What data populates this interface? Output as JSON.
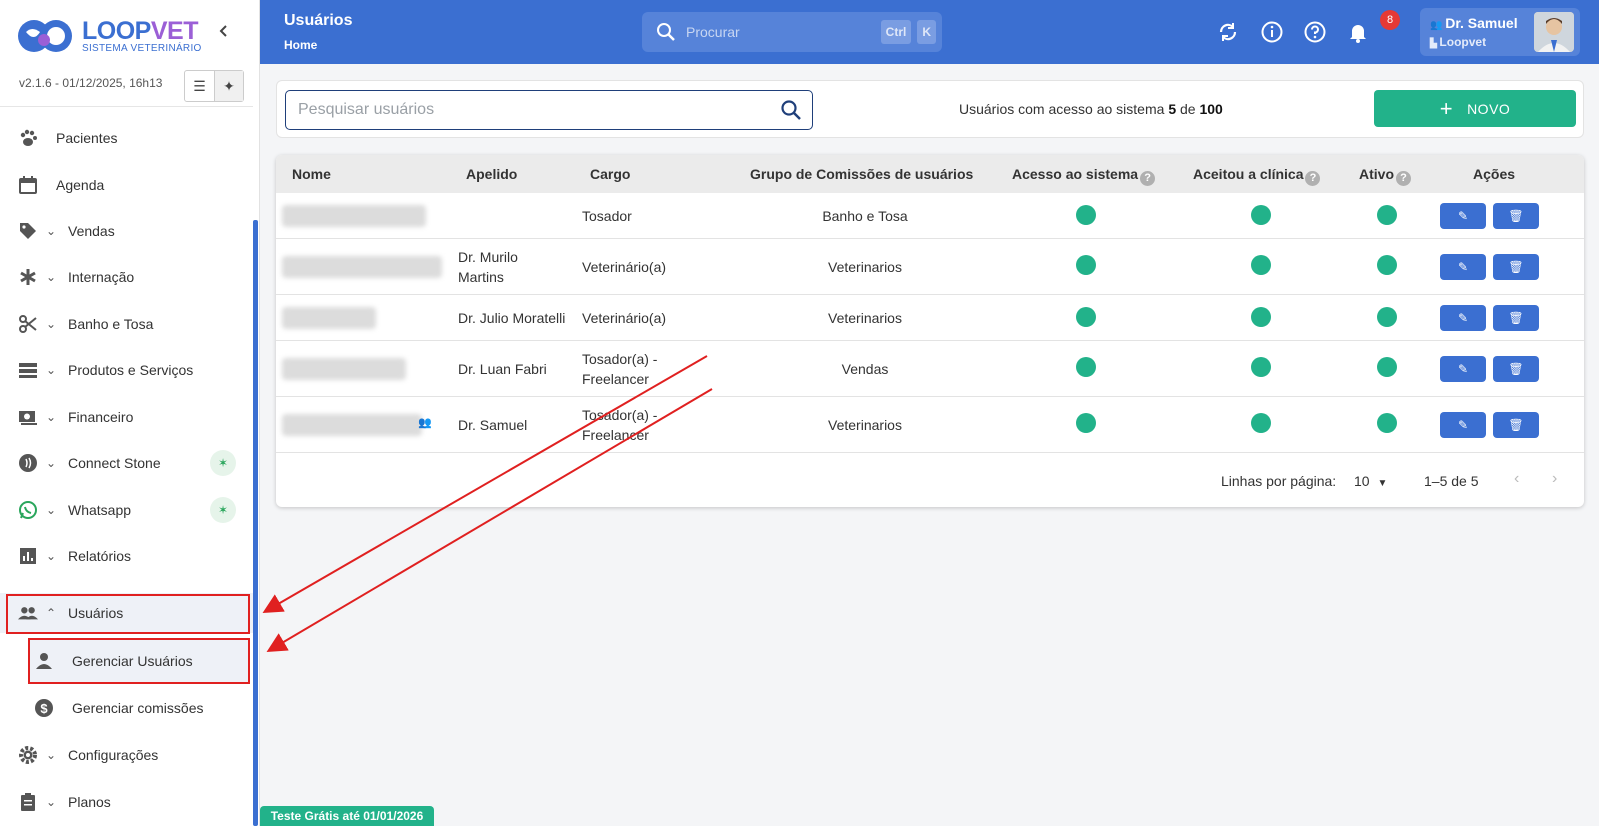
{
  "sidebar": {
    "logo": {
      "title_part1": "LOOP",
      "title_part2": "VET",
      "subtitle": "SISTEMA VETERINÁRIO"
    },
    "version": "v2.1.6 - 01/12/2025, 16h13",
    "items": [
      {
        "label": "Pacientes",
        "icon": "paw-icon"
      },
      {
        "label": "Agenda",
        "icon": "calendar-icon"
      },
      {
        "label": "Vendas",
        "icon": "tag-icon"
      },
      {
        "label": "Internação",
        "icon": "asterisk-icon"
      },
      {
        "label": "Banho e Tosa",
        "icon": "scissors-icon"
      },
      {
        "label": "Produtos e Serviços",
        "icon": "list-icon"
      },
      {
        "label": "Financeiro",
        "icon": "money-icon"
      },
      {
        "label": "Connect Stone",
        "icon": "contactless-icon"
      },
      {
        "label": "Whatsapp",
        "icon": "whatsapp-icon"
      },
      {
        "label": "Relatórios",
        "icon": "chart-icon"
      },
      {
        "label": "Usuários",
        "icon": "people-icon"
      },
      {
        "label": "Gerenciar Usuários",
        "icon": "person-icon"
      },
      {
        "label": "Gerenciar comissões",
        "icon": "dollar-icon"
      },
      {
        "label": "Configurações",
        "icon": "gear-icon"
      },
      {
        "label": "Planos",
        "icon": "clipboard-icon"
      }
    ]
  },
  "header": {
    "title": "Usuários",
    "breadcrumb": "Home",
    "search_placeholder": "Procurar",
    "kbd_ctrl": "Ctrl",
    "kbd_k": "K",
    "notification_count": "8",
    "user_name": "Dr. Samuel",
    "user_clinic": "Loopvet"
  },
  "toolbar": {
    "search_placeholder": "Pesquisar usuários",
    "access_prefix": "Usuários com acesso ao sistema",
    "access_used": "5",
    "access_of": "de",
    "access_total": "100",
    "new_label": "NOVO"
  },
  "table": {
    "headers": {
      "nome": "Nome",
      "apelido": "Apelido",
      "cargo": "Cargo",
      "grupo": "Grupo de Comissões de usuários",
      "acesso": "Acesso ao sistema",
      "aceitou": "Aceitou a clínica",
      "ativo": "Ativo",
      "acoes": "Ações"
    },
    "rows": [
      {
        "apelido": "",
        "cargo": "Tosador",
        "grupo": "Banho e Tosa",
        "acesso": true,
        "aceitou": true,
        "ativo": true
      },
      {
        "apelido": "Dr. Murilo Martins",
        "cargo": "Veterinário(a)",
        "grupo": "Veterinarios",
        "acesso": true,
        "aceitou": true,
        "ativo": true
      },
      {
        "apelido": "Dr. Julio Moratelli",
        "cargo": "Veterinário(a)",
        "grupo": "Veterinarios",
        "acesso": true,
        "aceitou": true,
        "ativo": true
      },
      {
        "apelido": "Dr. Luan Fabri",
        "cargo": "Tosador(a) - Freelancer",
        "grupo": "Vendas",
        "acesso": true,
        "aceitou": true,
        "ativo": true
      },
      {
        "apelido": "Dr. Samuel",
        "cargo": "Tosador(a) - Freelancer",
        "grupo": "Veterinarios",
        "acesso": true,
        "aceitou": true,
        "ativo": true
      }
    ],
    "pagination": {
      "rows_label": "Linhas por página:",
      "rows_value": "10",
      "range": "1–5 de 5"
    }
  },
  "trial_banner": "Teste Grátis até 01/01/2026",
  "colors": {
    "primary": "#3b6fd1",
    "success": "#22b28a",
    "highlight": "#e02020"
  }
}
